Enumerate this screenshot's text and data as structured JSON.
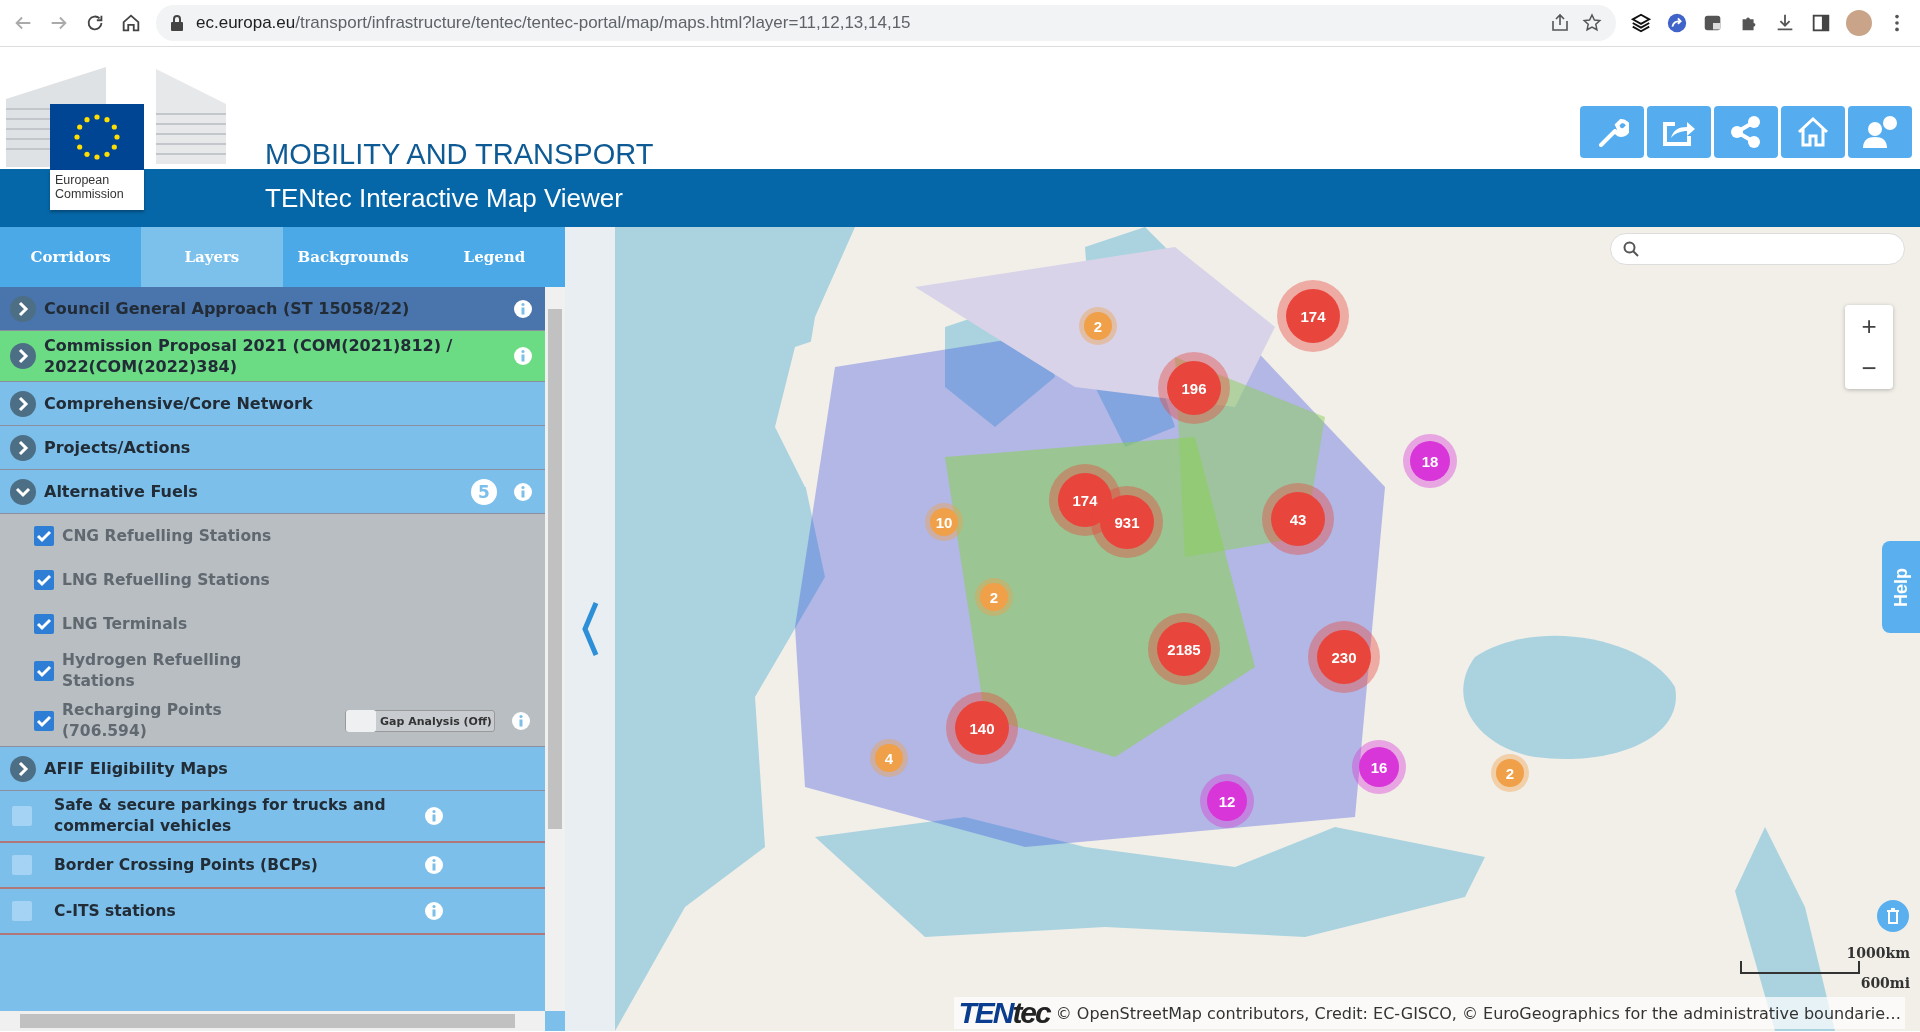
{
  "browser": {
    "url_domain": "ec.europa.eu",
    "url_path": "/transport/infrastructure/tentec/tentec-portal/map/maps.html?layer=11,12,13,14,15"
  },
  "header": {
    "logo_label": "European Commission",
    "title": "MOBILITY AND TRANSPORT",
    "subtitle": "TENtec Interactive Map Viewer"
  },
  "tabs": [
    {
      "label": "Corridors",
      "selected": false
    },
    {
      "label": "Layers",
      "selected": true
    },
    {
      "label": "Backgrounds",
      "selected": false
    },
    {
      "label": "Legend",
      "selected": false
    }
  ],
  "layers": [
    {
      "kind": "group",
      "label": "Council General Approach (ST 15058/22)",
      "expanded": false,
      "color": "#4a74ac",
      "info": true
    },
    {
      "kind": "group",
      "label": "Commission Proposal 2021 (COM(2021)812) / 2022(COM(2022)384)",
      "expanded": false,
      "color": "#6cdc84",
      "info": true
    },
    {
      "kind": "group",
      "label": "Comprehensive/Core Network",
      "expanded": false,
      "color": "#7cbfea",
      "info": false
    },
    {
      "kind": "group",
      "label": "Projects/Actions",
      "expanded": false,
      "color": "#7cbfea",
      "info": false
    },
    {
      "kind": "group",
      "label": "Alternative Fuels",
      "expanded": true,
      "color": "#7cbfea",
      "info": true,
      "badge": "5",
      "children": [
        {
          "kind": "check",
          "label": "CNG Refuelling Stations",
          "checked": true,
          "info": false
        },
        {
          "kind": "check",
          "label": "LNG Refuelling Stations",
          "checked": true,
          "info": false
        },
        {
          "kind": "check",
          "label": "LNG Terminals",
          "checked": true,
          "info": false
        },
        {
          "kind": "check",
          "label": "Hydrogen Refuelling Stations",
          "checked": true,
          "info": false
        },
        {
          "kind": "check",
          "label": "Recharging Points (706.594)",
          "checked": true,
          "info": true,
          "toggle": {
            "label": "Gap Analysis (Off)",
            "on": false
          }
        }
      ]
    },
    {
      "kind": "group",
      "label": "AFIF Eligibility Maps",
      "expanded": false,
      "color": "#7cbfea",
      "info": false
    },
    {
      "kind": "check",
      "label": "Safe & secure parkings for trucks and commercial vehicles",
      "checked": false,
      "info": true
    },
    {
      "kind": "check",
      "label": "Border Crossing Points (BCPs)",
      "checked": false,
      "info": true
    },
    {
      "kind": "check",
      "label": "C-ITS stations",
      "checked": false,
      "info": true
    }
  ],
  "map": {
    "clusters": [
      {
        "count": "174",
        "color": "#e8453c"
      },
      {
        "count": "2",
        "color": "#f0a048"
      },
      {
        "count": "196",
        "color": "#e8453c"
      },
      {
        "count": "18",
        "color": "#d836d8"
      },
      {
        "count": "10",
        "color": "#f0a048"
      },
      {
        "count": "174",
        "color": "#e8453c"
      },
      {
        "count": "931",
        "color": "#e8453c"
      },
      {
        "count": "43",
        "color": "#e8453c"
      },
      {
        "count": "2",
        "color": "#f0a048"
      },
      {
        "count": "2185",
        "color": "#e8453c"
      },
      {
        "count": "230",
        "color": "#e8453c"
      },
      {
        "count": "140",
        "color": "#e8453c"
      },
      {
        "count": "4",
        "color": "#f0a048"
      },
      {
        "count": "16",
        "color": "#d836d8"
      },
      {
        "count": "2",
        "color": "#f0a048"
      },
      {
        "count": "12",
        "color": "#d836d8"
      }
    ],
    "zoom_in": "+",
    "zoom_out": "−",
    "help": "Help",
    "scale_km": "1000km",
    "scale_mi": "600mi",
    "logo": "**TEN**tec",
    "attribution": "© OpenStreetMap contributors, Credit: EC-GISCO, © EuroGeographics for the administrative boundarie…"
  }
}
